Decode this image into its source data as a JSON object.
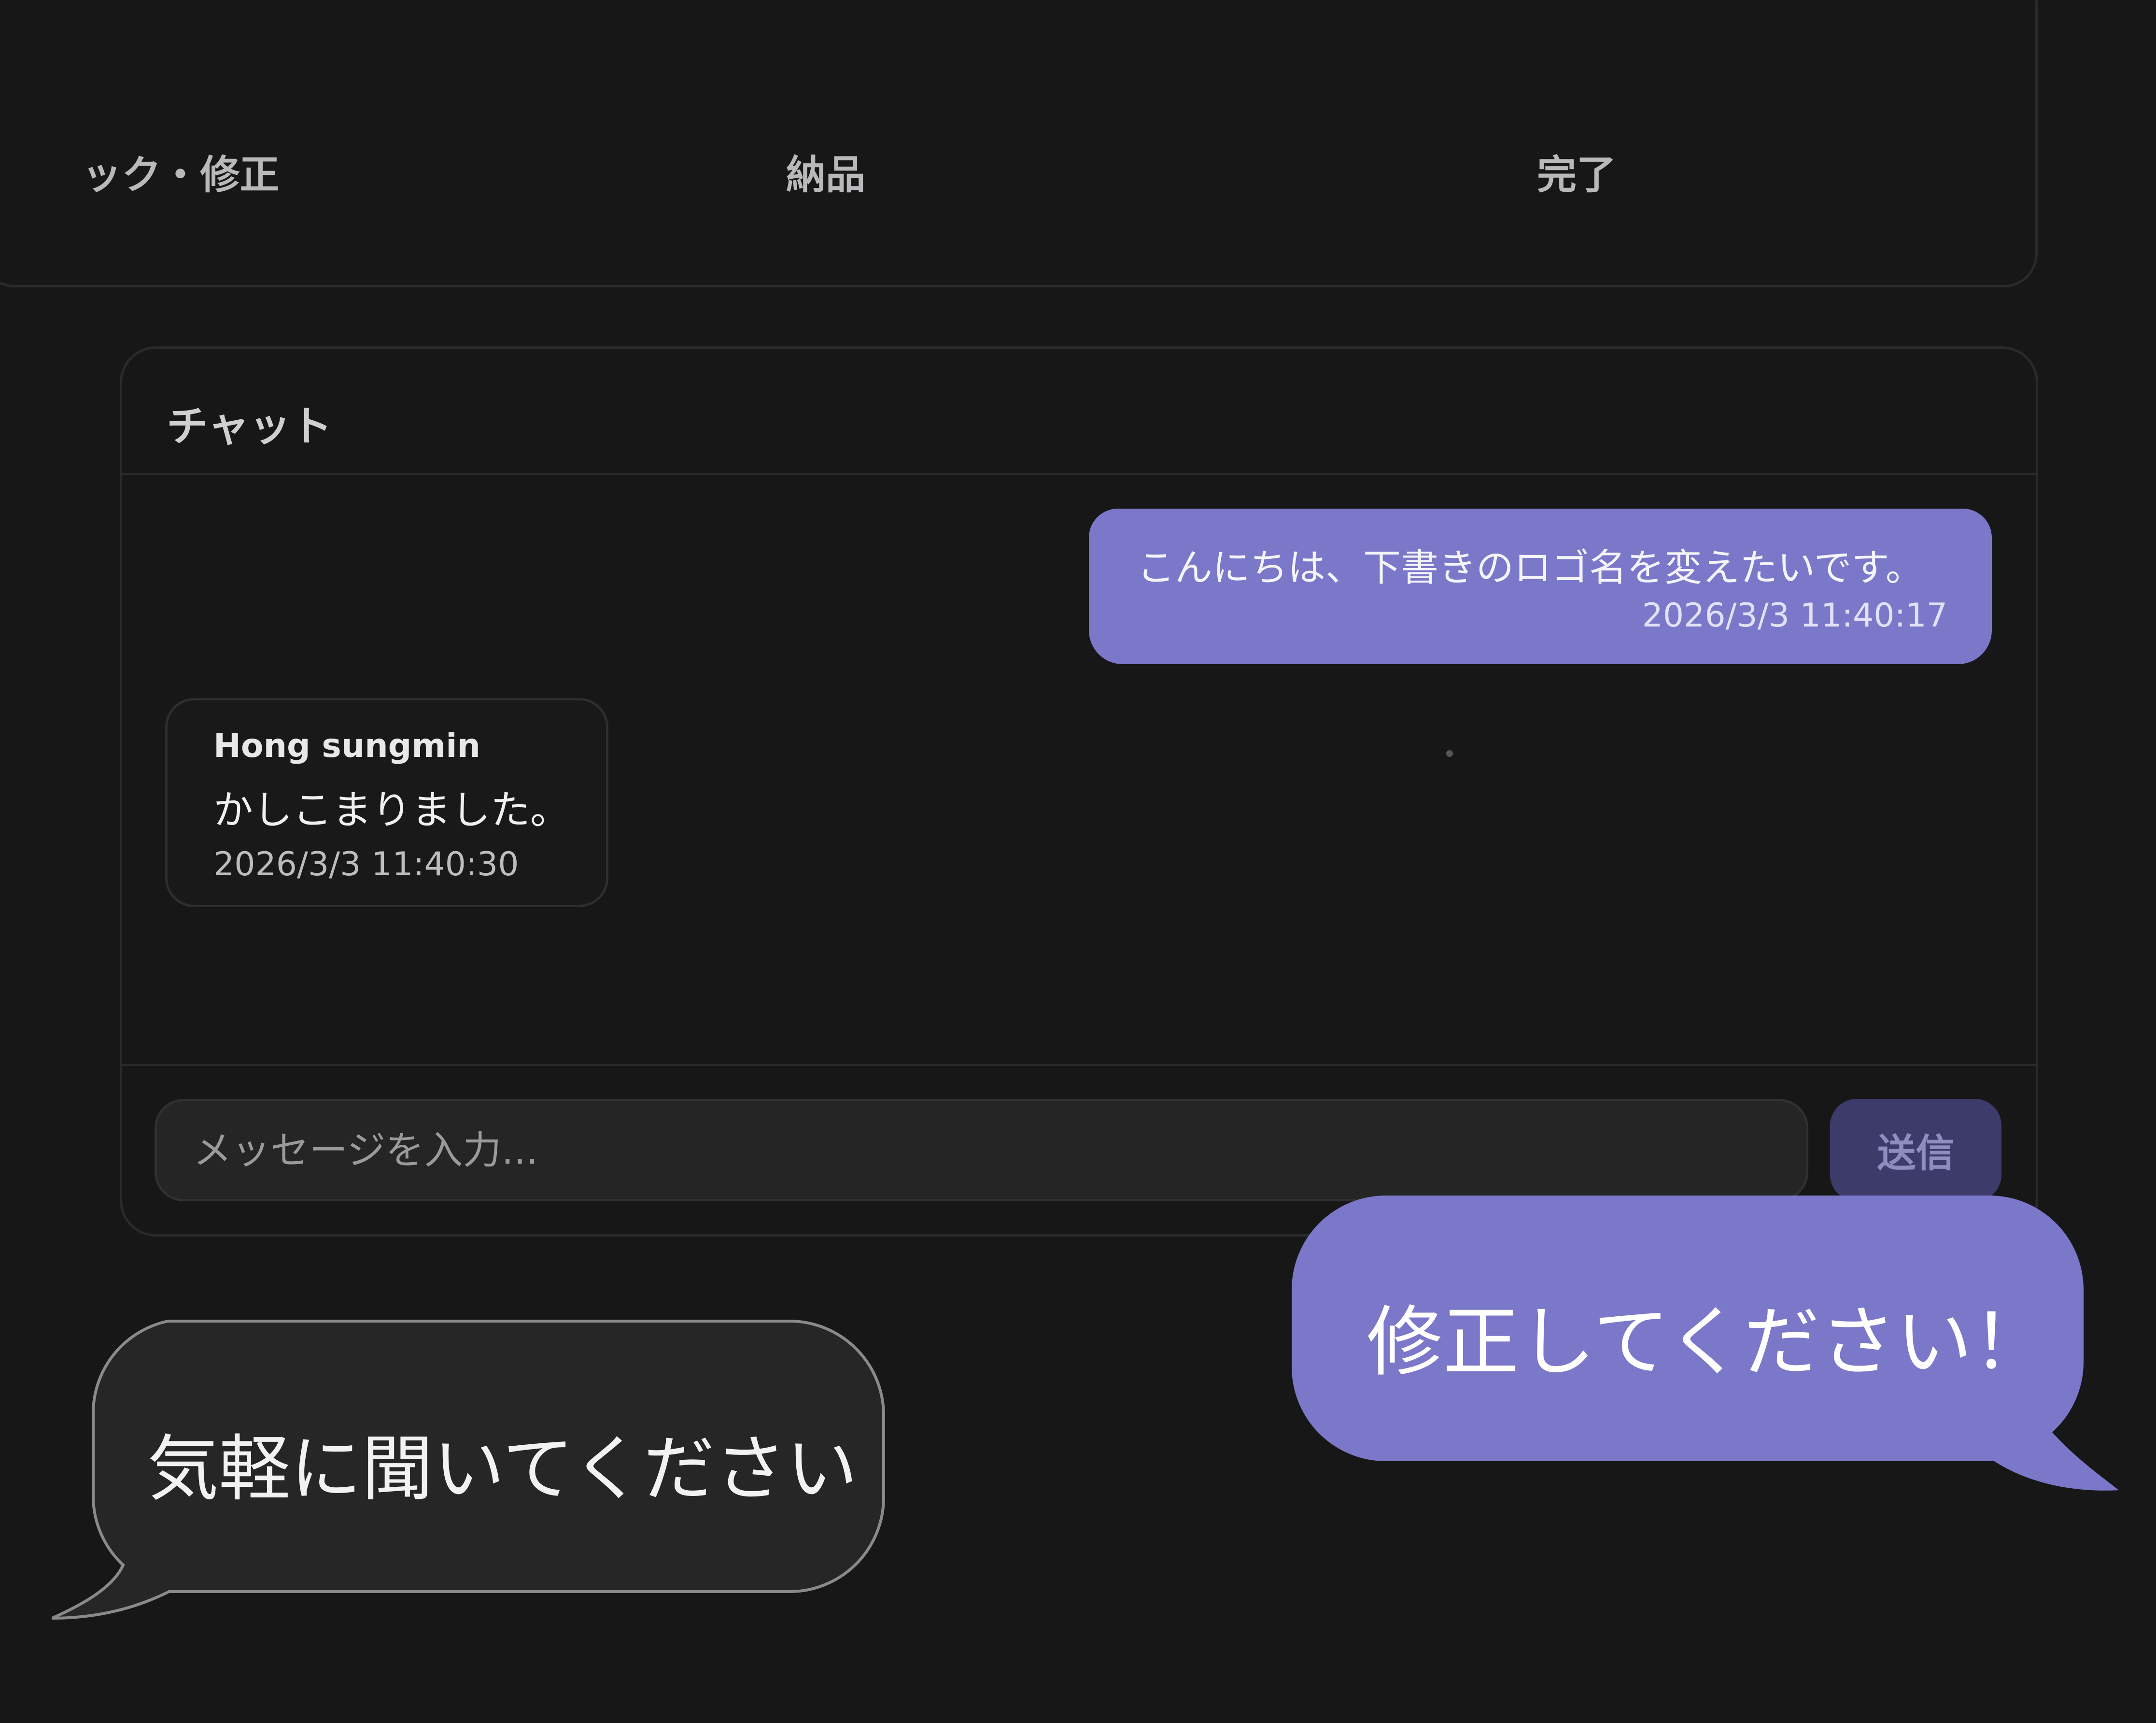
{
  "steps": {
    "check_label": "ック・修正",
    "deliver_label": "納品",
    "done_label": "完了"
  },
  "chat": {
    "title": "チャット",
    "messages": [
      {
        "direction": "outgoing",
        "text": "こんにちは、下書きのロゴ名を変えたいです。",
        "time": "2026/3/3 11:40:17"
      },
      {
        "direction": "incoming",
        "sender": "Hong sungmin",
        "text": "かしこまりました。",
        "time": "2026/3/3 11:40:30"
      }
    ],
    "input_placeholder": "メッセージを入力...",
    "send_label": "送信"
  },
  "callouts": {
    "left_text": "気軽に聞いてください",
    "right_text": "修正してください！"
  },
  "colors": {
    "background": "#171718",
    "accent": "#7b78c9",
    "send_button": "#3d3b69",
    "callout_dark": "#262627"
  }
}
